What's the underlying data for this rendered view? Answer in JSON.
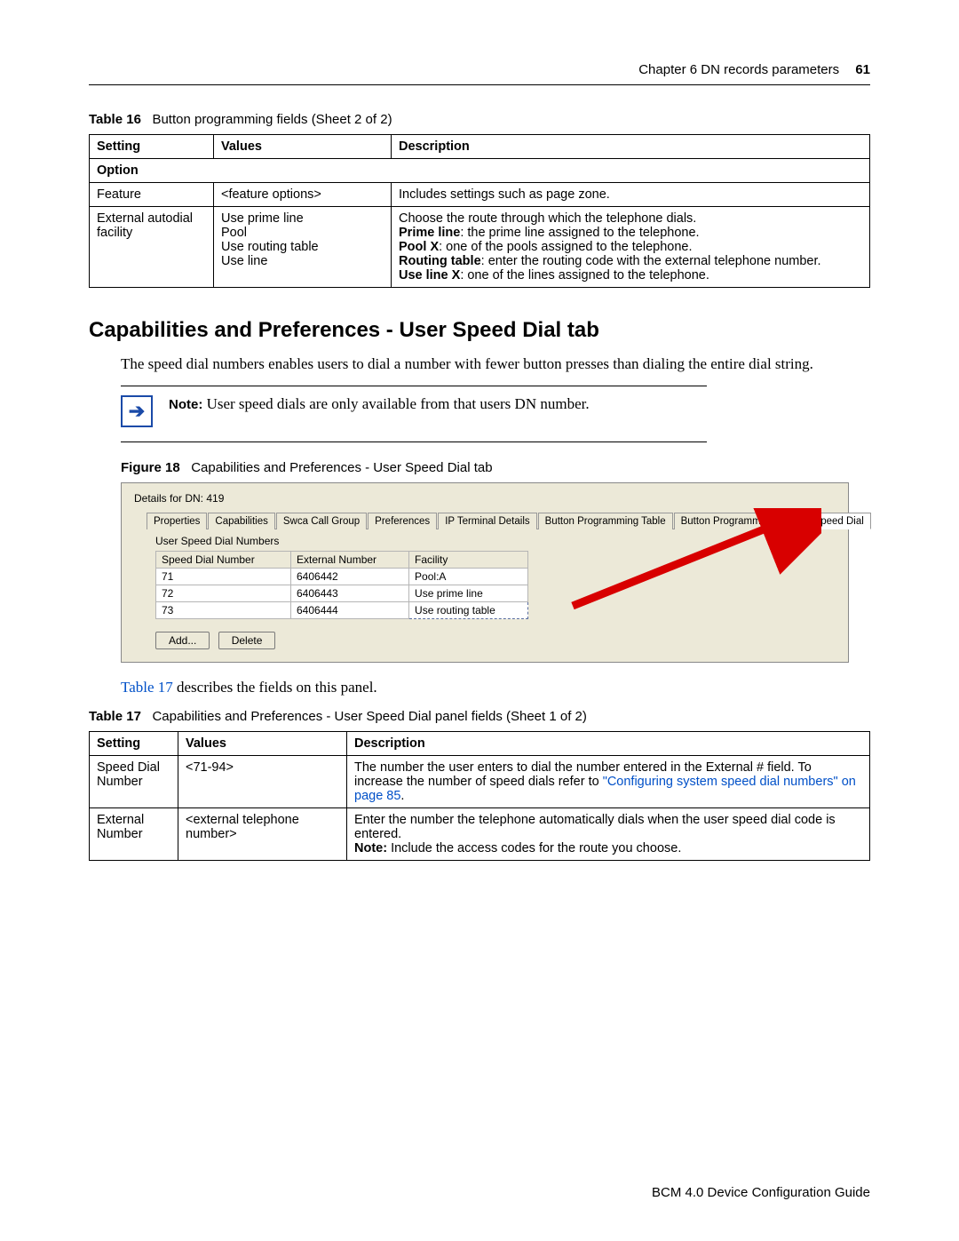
{
  "header": {
    "chapter": "Chapter 6  DN records parameters",
    "page": "61"
  },
  "table16": {
    "caption_label": "Table 16",
    "caption_text": "Button programming fields (Sheet 2 of 2)",
    "h1": "Setting",
    "h2": "Values",
    "h3": "Description",
    "option_label": "Option",
    "rows": [
      {
        "setting": "Feature",
        "values": "<feature options>",
        "desc": "Includes settings such as page zone."
      },
      {
        "setting": "External autodial facility",
        "values_lines": [
          "Use prime line",
          "Pool",
          "Use routing table",
          "Use line"
        ],
        "desc_parts": {
          "l1": "Choose the route through which the telephone dials.",
          "prime_b": "Prime line",
          "prime_t": ": the prime line assigned to the telephone.",
          "pool_b": "Pool X",
          "pool_t": ": one of the pools assigned to the telephone.",
          "route_b": "Routing table",
          "route_t": ": enter the routing code with the external telephone number.",
          "line_b": "Use line X",
          "line_t": ": one of the lines assigned to the telephone."
        }
      }
    ]
  },
  "section_heading": "Capabilities and Preferences - User Speed Dial tab",
  "body_p1": "The speed dial numbers enables users to dial a number with fewer button presses than dialing the entire dial string.",
  "note": {
    "label": "Note:",
    "text": " User speed dials are only available from that users DN number."
  },
  "figure18": {
    "label": "Figure 18",
    "text": "Capabilities and Preferences - User Speed Dial tab"
  },
  "screenshot": {
    "title": "Details for DN: 419",
    "tabs": [
      "Properties",
      "Capabilities",
      "Swca Call Group",
      "Preferences",
      "IP Terminal Details",
      "Button Programming Table",
      "Button Programming",
      "User Speed Dial"
    ],
    "active_tab": "User Speed Dial",
    "sublabel": "User Speed Dial Numbers",
    "cols": [
      "Speed Dial Number",
      "External Number",
      "Facility"
    ],
    "rows": [
      {
        "sdn": "71",
        "ext": "6406442",
        "fac": "Pool:A"
      },
      {
        "sdn": "72",
        "ext": "6406443",
        "fac": "Use prime line"
      },
      {
        "sdn": "73",
        "ext": "6406444",
        "fac": "Use routing table"
      }
    ],
    "btn_add": "Add...",
    "btn_delete": "Delete"
  },
  "link_sentence": {
    "pre": "Table 17",
    "post": " describes the fields on this panel."
  },
  "table17": {
    "caption_label": "Table 17",
    "caption_text": "Capabilities and Preferences - User Speed Dial panel fields (Sheet 1 of 2)",
    "h1": "Setting",
    "h2": "Values",
    "h3": "Description",
    "rows": [
      {
        "setting": "Speed Dial Number",
        "values": "<71-94>",
        "desc_pre": "The number the user enters to dial the number entered in the External # field. To increase the number of speed dials refer to ",
        "desc_link": "\"Configuring system speed dial numbers\" on page 85",
        "desc_post": "."
      },
      {
        "setting": "External Number",
        "values": "<external telephone number>",
        "desc_l1": "Enter the number the telephone automatically dials when the user speed dial code is entered.",
        "desc_note_b": "Note:",
        "desc_note_t": " Include the access codes for the route you choose."
      }
    ]
  },
  "footer": "BCM 4.0 Device Configuration Guide"
}
